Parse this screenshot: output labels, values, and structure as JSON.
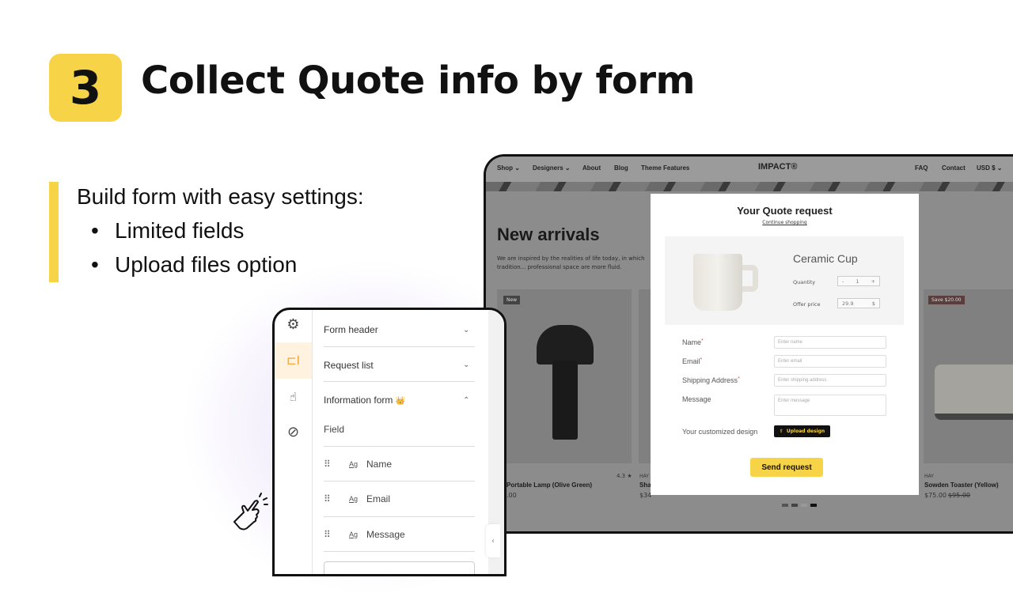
{
  "slide": {
    "step_number": "3",
    "title": "Collect Quote info by form",
    "lead": "Build form with easy settings:",
    "bullets": [
      "Limited fields",
      "Upload files option"
    ],
    "accent_color": "#f7d347"
  },
  "store": {
    "nav_left": [
      "Shop ⌄",
      "Designers ⌄",
      "About",
      "Blog",
      "Theme Features"
    ],
    "logo": "IMPACT®",
    "nav_right": [
      "FAQ",
      "Contact",
      "USD $ ⌄"
    ],
    "heading": "New arrivals",
    "intro": "We are inspired by the realities of life today, in which tradition... professional space are more fluid.",
    "products": [
      {
        "badge": "New",
        "rating": "4.3 ★",
        "name": "Portable Lamp (Olive Green)",
        "price": ".00"
      },
      {
        "vendor": "HAY",
        "name": "Sha",
        "price": "$34"
      },
      {
        "badge": "Save $20.00",
        "vendor": "HAY",
        "name": "Sowden Toaster (Yellow)",
        "price": "$75.00",
        "compare_price": "$95.00"
      }
    ]
  },
  "modal": {
    "title": "Your Quote request",
    "continue_link": "Continue shopping",
    "product": {
      "name": "Ceramic Cup",
      "quantity_label": "Quantity",
      "quantity": "1",
      "minus": "-",
      "plus": "+",
      "offer_label": "Offer price",
      "offer_value": "29.9",
      "currency": "$"
    },
    "fields": [
      {
        "label": "Name",
        "required": "*",
        "placeholder": "Enter name"
      },
      {
        "label": "Email",
        "required": "*",
        "placeholder": "Enter email"
      },
      {
        "label": "Shipping Address",
        "required": "*",
        "placeholder": "Enter shipping address"
      },
      {
        "label": "Message",
        "required": "",
        "placeholder": "Enter message"
      }
    ],
    "upload_label": "Your customized design",
    "upload_button": "Upload design",
    "send_button": "Send request"
  },
  "panel": {
    "sections": [
      "Form header",
      "Request list",
      "Information form"
    ],
    "crown": "👑",
    "field_heading": "Field",
    "fields": [
      "Name",
      "Email",
      "Message"
    ],
    "icons": [
      "gear-icon",
      "form-icon",
      "hand-button-icon",
      "block-icon"
    ]
  }
}
